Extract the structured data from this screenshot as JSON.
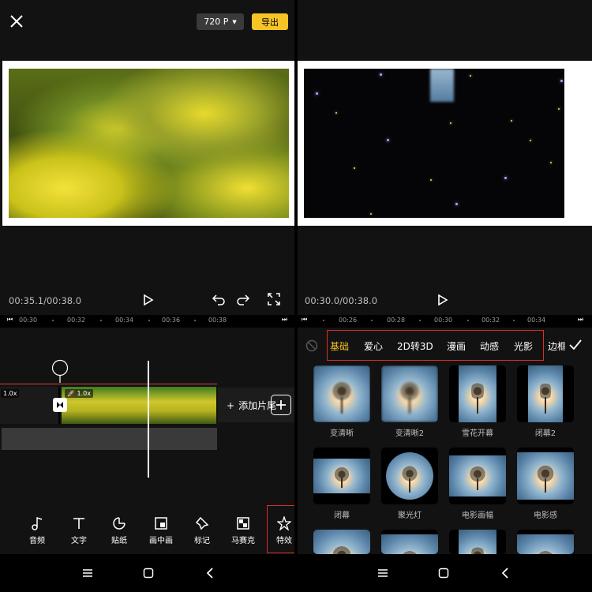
{
  "top_bar": {
    "resolution": "720 P",
    "export_label": "导出"
  },
  "left": {
    "timecode": "00:35.1/00:38.0",
    "ruler": {
      "ticks": [
        "00:30",
        "00:32",
        "00:34",
        "00:36",
        "00:38"
      ]
    },
    "clips": [
      {
        "speed": "1.0x"
      },
      {
        "speed": "1.0x"
      }
    ],
    "add_clip_label": "添加片尾",
    "toolbar": [
      {
        "label": "音频",
        "icon": "music-note-icon"
      },
      {
        "label": "文字",
        "icon": "text-icon"
      },
      {
        "label": "贴纸",
        "icon": "sticker-icon"
      },
      {
        "label": "画中画",
        "icon": "pip-icon"
      },
      {
        "label": "标记",
        "icon": "pin-icon"
      },
      {
        "label": "马赛克",
        "icon": "mosaic-icon"
      },
      {
        "label": "特效",
        "icon": "effects-icon"
      }
    ]
  },
  "right": {
    "timecode": "00:30.0/00:38.0",
    "ruler": {
      "ticks": [
        "00:26",
        "00:28",
        "00:30",
        "00:32",
        "00:34"
      ]
    },
    "categories": [
      {
        "label": "基础",
        "active": true
      },
      {
        "label": "爱心",
        "active": false
      },
      {
        "label": "2D转3D",
        "active": false
      },
      {
        "label": "漫画",
        "active": false
      },
      {
        "label": "动感",
        "active": false
      },
      {
        "label": "光影",
        "active": false
      },
      {
        "label": "边框",
        "active": false
      }
    ],
    "effects": [
      {
        "label": "变清晰"
      },
      {
        "label": "变清晰2"
      },
      {
        "label": "雪花开幕"
      },
      {
        "label": "闭幕2"
      },
      {
        "label": "闭幕"
      },
      {
        "label": "聚光灯"
      },
      {
        "label": "电影画幅"
      },
      {
        "label": "电影感"
      }
    ]
  },
  "colors": {
    "accent": "#f7c425",
    "highlight": "#e02a2a"
  }
}
